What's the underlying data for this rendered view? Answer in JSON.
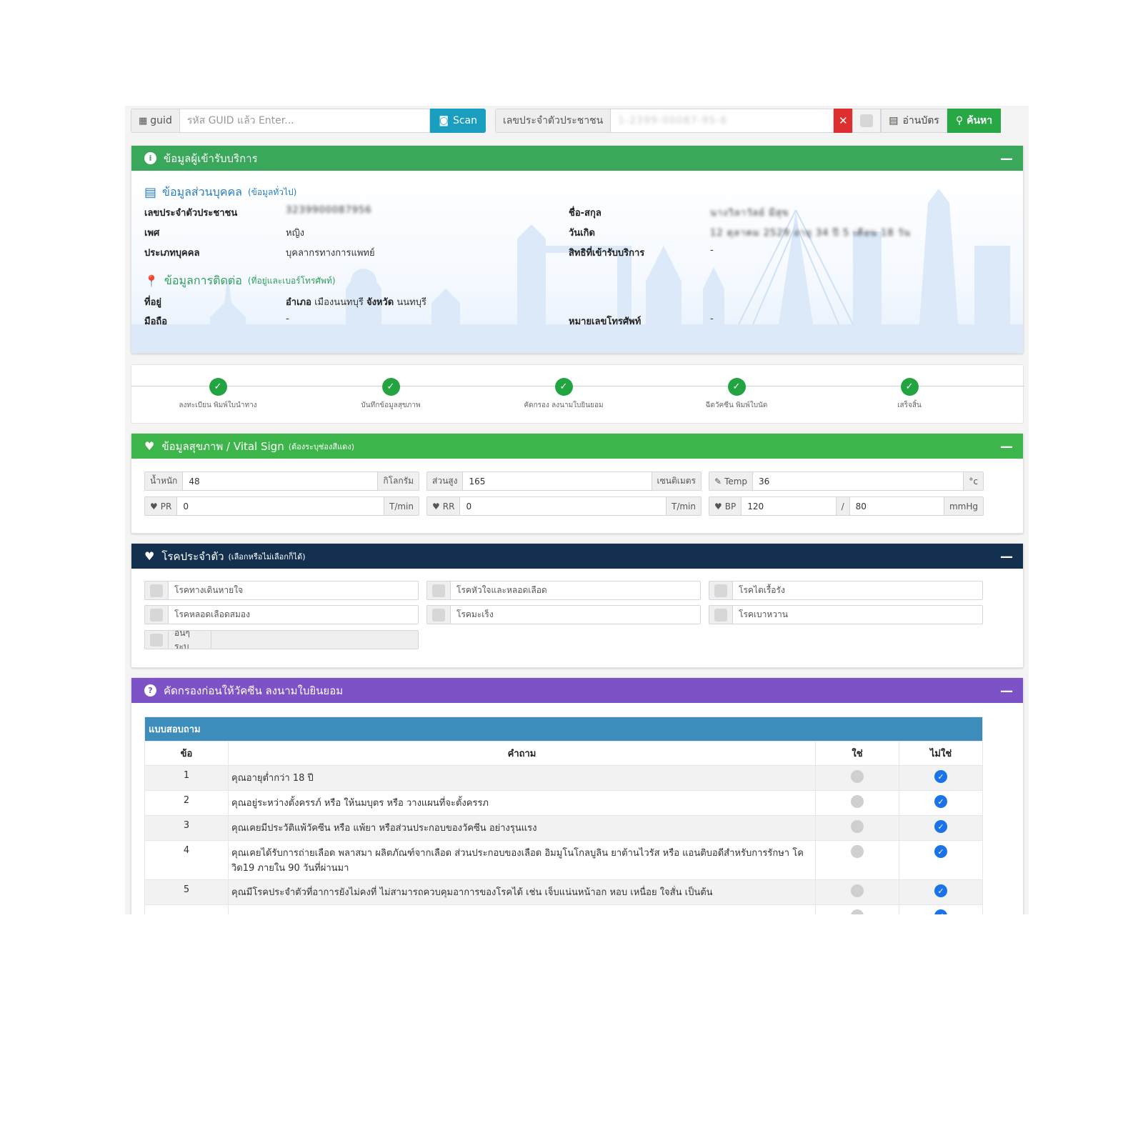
{
  "search": {
    "guid_label": "guid",
    "guid_placeholder": "รหัส GUID แล้ว Enter...",
    "scan_label": "Scan",
    "citizen_label": "เลขประจำตัวประชาชน",
    "citizen_value": "1-2399-00087-95-6",
    "card_label": "อ่านบัตร",
    "search_label": "ค้นหา"
  },
  "patient_box": {
    "title": "ข้อมูลผู้เข้ารับบริการ",
    "personal_title": "ข้อมูลส่วนบุคคล",
    "personal_sub": "(ข้อมูลทั่วไป)",
    "labels": {
      "citizen_id": "เลขประจำตัวประชาชน",
      "gender": "เพศ",
      "person_type": "ประเภทบุคคล",
      "fullname": "ชื่อ-สกุล",
      "birthdate": "วันเกิด",
      "rights": "สิทธิที่เข้ารับบริการ"
    },
    "values": {
      "citizen_id": "3239900087956",
      "gender": "หญิง",
      "person_type": "บุคลากรทางการแพทย์",
      "fullname": "นางวิลาวัลย์ มีสุข",
      "birthdate": "12 ตุลาคม 2529   อายุ 34 ปี 5 เดือน 18 วัน",
      "rights": "-"
    },
    "contact_title": "ข้อมูลการติดต่อ",
    "contact_sub": "(ที่อยู่และเบอร์โทรศัพท์)",
    "contact_labels": {
      "address": "ที่อยู่",
      "mobile": "มือถือ",
      "phone": "หมายเลขโทรศัพท์"
    },
    "address": {
      "district_label": "อำเภอ",
      "district": "เมืองนนทบุรี",
      "province_label": "จังหวัด",
      "province": "นนทบุรี"
    },
    "mobile": "-",
    "phone": "-"
  },
  "steps": [
    {
      "label": "ลงทะเบียน พิมพ์ใบนำทาง"
    },
    {
      "label": "บันทึกข้อมูลสุขภาพ"
    },
    {
      "label": "คัดกรอง ลงนามใบยินยอม"
    },
    {
      "label": "ฉีดวัคซีน พิมพ์ใบนัด"
    },
    {
      "label": "เสร็จสิ้น"
    }
  ],
  "vital": {
    "title": "ข้อมูลสุขภาพ / Vital Sign",
    "sub": "(ต้องระบุช่องสีแดง)",
    "weight_label": "น้ำหนัก",
    "weight": "48",
    "weight_unit": "กิโลกรัม",
    "height_label": "ส่วนสูง",
    "height": "165",
    "height_unit": "เซนติเมตร",
    "temp_label": "Temp",
    "temp": "36",
    "temp_unit": "°c",
    "pr_label": "PR",
    "pr": "0",
    "pr_unit": "T/min",
    "rr_label": "RR",
    "rr": "0",
    "rr_unit": "T/min",
    "bp_label": "BP",
    "bp_sys": "120",
    "bp_sep": "/",
    "bp_dia": "80",
    "bp_unit": "mmHg"
  },
  "diseases": {
    "title": "โรคประจำตัว",
    "sub": "(เลือกหรือไม่เลือกก็ได้)",
    "items": [
      "โรคทางเดินหายใจ",
      "โรคหัวใจและหลอดเลือด",
      "โรคไตเรื้อรัง",
      "โรคหลอดเลือดสมอง",
      "โรคมะเร็ง",
      "โรคเบาหวาน"
    ],
    "other_label": "อื่นๆ ระบุ"
  },
  "screening": {
    "title": "คัดกรองก่อนให้วัคซีน ลงนามใบยินยอม",
    "table_caption": "แบบสอบถาม",
    "headers": {
      "no": "ข้อ",
      "question": "คำถาม",
      "yes": "ใช่",
      "no_ans": "ไม่ใช่"
    },
    "rows": [
      {
        "no": "1",
        "q": "คุณอายุต่ำกว่า 18 ปี",
        "answer": "no"
      },
      {
        "no": "2",
        "q": "คุณอยู่ระหว่างตั้งครรภ์ หรือ ให้นมบุตร หรือ วางแผนที่จะตั้งครรภ",
        "answer": "no"
      },
      {
        "no": "3",
        "q": "คุณเคยมีประวัติแพ้วัคซีน หรือ แพ้ยา หรือส่วนประกอบของวัคซีน อย่างรุนแรง",
        "answer": "no"
      },
      {
        "no": "4",
        "q": "คุณเคยได้รับการถ่ายเลือด พลาสมา ผลิตภัณฑ์จากเลือด ส่วนประกอบของเลือด อิมมูโนโกลบูลิน ยาต้านไวรัส หรือ แอนติบอดีสำหรับการรักษา โควิด19 ภายใน 90 วันที่ผ่านมา",
        "answer": "no"
      },
      {
        "no": "5",
        "q": "คุณมีโรคประจำตัวที่อาการยังไม่คงที่ ไม่สามารถควบคุมอาการของโรคได้ เช่น เจ็บแน่นหน้าอก หอบ เหนื่อย ใจสั่น เป็นต้น",
        "answer": "no"
      }
    ]
  },
  "colors": {
    "green": "#3aa85a",
    "navy": "#13304f",
    "purple": "#7e52c7",
    "teal": "#1a9ebf",
    "red": "#dd2f2f",
    "blue": "#3c8dbc"
  }
}
